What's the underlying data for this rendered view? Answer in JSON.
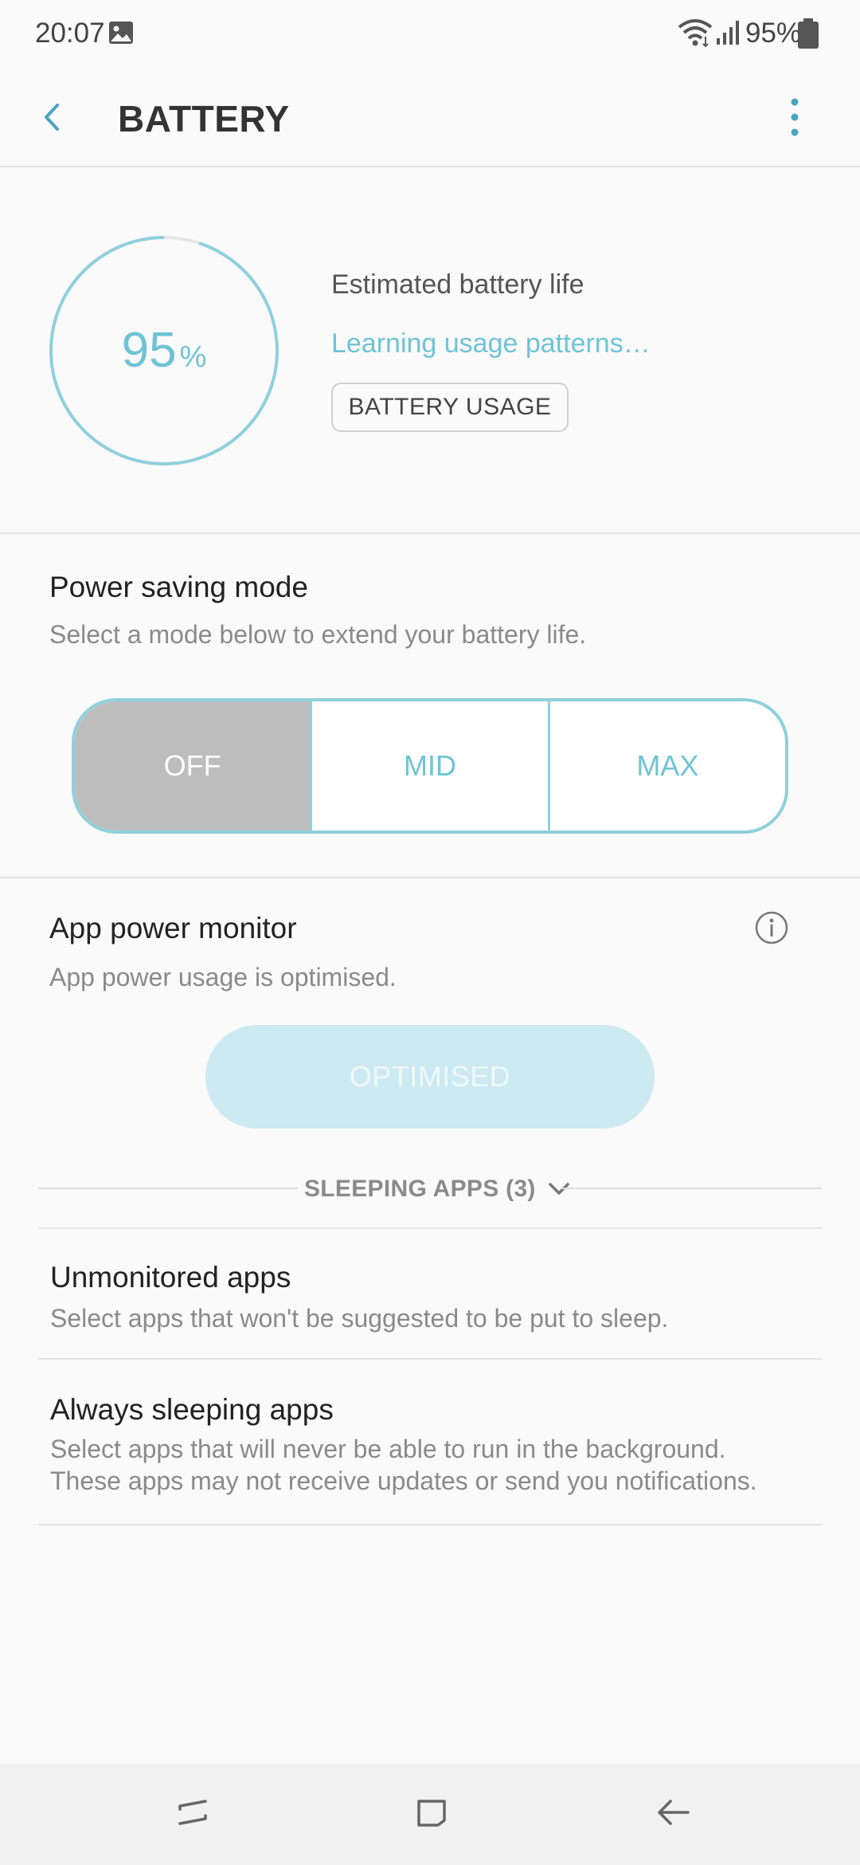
{
  "status_bar": {
    "time": "20:07",
    "battery_percent": "95%",
    "icons": [
      "gallery-icon",
      "wifi-icon",
      "signal-icon",
      "battery-icon"
    ]
  },
  "header": {
    "title": "BATTERY",
    "back_icon": "back-arrow-icon",
    "more_icon": "more-vertical-icon"
  },
  "battery": {
    "level": 95,
    "level_text": "95",
    "unit": "%",
    "estimated_label": "Estimated battery life",
    "learning_text": "Learning usage patterns…",
    "usage_button": "BATTERY USAGE"
  },
  "power_saving": {
    "title": "Power saving mode",
    "description": "Select a mode below to extend your battery life.",
    "modes": [
      "OFF",
      "MID",
      "MAX"
    ],
    "selected": "OFF"
  },
  "app_power_monitor": {
    "title": "App power monitor",
    "description": "App power usage is optimised.",
    "button": "OPTIMISED",
    "info_icon": "info-icon"
  },
  "sleeping_apps": {
    "label": "SLEEPING APPS (3)"
  },
  "list": {
    "unmonitored": {
      "title": "Unmonitored apps",
      "description": "Select apps that won't be suggested to be put to sleep."
    },
    "always_sleeping": {
      "title": "Always sleeping apps",
      "description_line1": "Select apps that will never be able to run in the background.",
      "description_line2": "These apps may not receive updates or send you notifications."
    }
  },
  "colors": {
    "accent": "#6fc3d6",
    "ring": "#8fd0dc",
    "selected_segment": "#bdbdbd",
    "optimised_bg": "#cde9f1"
  }
}
